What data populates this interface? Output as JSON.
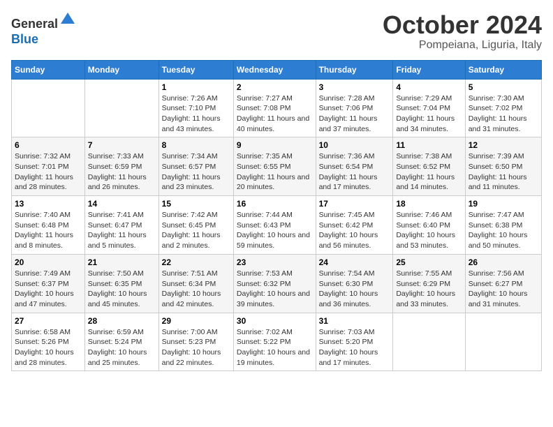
{
  "header": {
    "logo_general": "General",
    "logo_blue": "Blue",
    "month": "October 2024",
    "location": "Pompeiana, Liguria, Italy"
  },
  "days_of_week": [
    "Sunday",
    "Monday",
    "Tuesday",
    "Wednesday",
    "Thursday",
    "Friday",
    "Saturday"
  ],
  "weeks": [
    [
      {
        "num": "",
        "sunrise": "",
        "sunset": "",
        "daylight": ""
      },
      {
        "num": "",
        "sunrise": "",
        "sunset": "",
        "daylight": ""
      },
      {
        "num": "1",
        "sunrise": "Sunrise: 7:26 AM",
        "sunset": "Sunset: 7:10 PM",
        "daylight": "Daylight: 11 hours and 43 minutes."
      },
      {
        "num": "2",
        "sunrise": "Sunrise: 7:27 AM",
        "sunset": "Sunset: 7:08 PM",
        "daylight": "Daylight: 11 hours and 40 minutes."
      },
      {
        "num": "3",
        "sunrise": "Sunrise: 7:28 AM",
        "sunset": "Sunset: 7:06 PM",
        "daylight": "Daylight: 11 hours and 37 minutes."
      },
      {
        "num": "4",
        "sunrise": "Sunrise: 7:29 AM",
        "sunset": "Sunset: 7:04 PM",
        "daylight": "Daylight: 11 hours and 34 minutes."
      },
      {
        "num": "5",
        "sunrise": "Sunrise: 7:30 AM",
        "sunset": "Sunset: 7:02 PM",
        "daylight": "Daylight: 11 hours and 31 minutes."
      }
    ],
    [
      {
        "num": "6",
        "sunrise": "Sunrise: 7:32 AM",
        "sunset": "Sunset: 7:01 PM",
        "daylight": "Daylight: 11 hours and 28 minutes."
      },
      {
        "num": "7",
        "sunrise": "Sunrise: 7:33 AM",
        "sunset": "Sunset: 6:59 PM",
        "daylight": "Daylight: 11 hours and 26 minutes."
      },
      {
        "num": "8",
        "sunrise": "Sunrise: 7:34 AM",
        "sunset": "Sunset: 6:57 PM",
        "daylight": "Daylight: 11 hours and 23 minutes."
      },
      {
        "num": "9",
        "sunrise": "Sunrise: 7:35 AM",
        "sunset": "Sunset: 6:55 PM",
        "daylight": "Daylight: 11 hours and 20 minutes."
      },
      {
        "num": "10",
        "sunrise": "Sunrise: 7:36 AM",
        "sunset": "Sunset: 6:54 PM",
        "daylight": "Daylight: 11 hours and 17 minutes."
      },
      {
        "num": "11",
        "sunrise": "Sunrise: 7:38 AM",
        "sunset": "Sunset: 6:52 PM",
        "daylight": "Daylight: 11 hours and 14 minutes."
      },
      {
        "num": "12",
        "sunrise": "Sunrise: 7:39 AM",
        "sunset": "Sunset: 6:50 PM",
        "daylight": "Daylight: 11 hours and 11 minutes."
      }
    ],
    [
      {
        "num": "13",
        "sunrise": "Sunrise: 7:40 AM",
        "sunset": "Sunset: 6:48 PM",
        "daylight": "Daylight: 11 hours and 8 minutes."
      },
      {
        "num": "14",
        "sunrise": "Sunrise: 7:41 AM",
        "sunset": "Sunset: 6:47 PM",
        "daylight": "Daylight: 11 hours and 5 minutes."
      },
      {
        "num": "15",
        "sunrise": "Sunrise: 7:42 AM",
        "sunset": "Sunset: 6:45 PM",
        "daylight": "Daylight: 11 hours and 2 minutes."
      },
      {
        "num": "16",
        "sunrise": "Sunrise: 7:44 AM",
        "sunset": "Sunset: 6:43 PM",
        "daylight": "Daylight: 10 hours and 59 minutes."
      },
      {
        "num": "17",
        "sunrise": "Sunrise: 7:45 AM",
        "sunset": "Sunset: 6:42 PM",
        "daylight": "Daylight: 10 hours and 56 minutes."
      },
      {
        "num": "18",
        "sunrise": "Sunrise: 7:46 AM",
        "sunset": "Sunset: 6:40 PM",
        "daylight": "Daylight: 10 hours and 53 minutes."
      },
      {
        "num": "19",
        "sunrise": "Sunrise: 7:47 AM",
        "sunset": "Sunset: 6:38 PM",
        "daylight": "Daylight: 10 hours and 50 minutes."
      }
    ],
    [
      {
        "num": "20",
        "sunrise": "Sunrise: 7:49 AM",
        "sunset": "Sunset: 6:37 PM",
        "daylight": "Daylight: 10 hours and 47 minutes."
      },
      {
        "num": "21",
        "sunrise": "Sunrise: 7:50 AM",
        "sunset": "Sunset: 6:35 PM",
        "daylight": "Daylight: 10 hours and 45 minutes."
      },
      {
        "num": "22",
        "sunrise": "Sunrise: 7:51 AM",
        "sunset": "Sunset: 6:34 PM",
        "daylight": "Daylight: 10 hours and 42 minutes."
      },
      {
        "num": "23",
        "sunrise": "Sunrise: 7:53 AM",
        "sunset": "Sunset: 6:32 PM",
        "daylight": "Daylight: 10 hours and 39 minutes."
      },
      {
        "num": "24",
        "sunrise": "Sunrise: 7:54 AM",
        "sunset": "Sunset: 6:30 PM",
        "daylight": "Daylight: 10 hours and 36 minutes."
      },
      {
        "num": "25",
        "sunrise": "Sunrise: 7:55 AM",
        "sunset": "Sunset: 6:29 PM",
        "daylight": "Daylight: 10 hours and 33 minutes."
      },
      {
        "num": "26",
        "sunrise": "Sunrise: 7:56 AM",
        "sunset": "Sunset: 6:27 PM",
        "daylight": "Daylight: 10 hours and 31 minutes."
      }
    ],
    [
      {
        "num": "27",
        "sunrise": "Sunrise: 6:58 AM",
        "sunset": "Sunset: 5:26 PM",
        "daylight": "Daylight: 10 hours and 28 minutes."
      },
      {
        "num": "28",
        "sunrise": "Sunrise: 6:59 AM",
        "sunset": "Sunset: 5:24 PM",
        "daylight": "Daylight: 10 hours and 25 minutes."
      },
      {
        "num": "29",
        "sunrise": "Sunrise: 7:00 AM",
        "sunset": "Sunset: 5:23 PM",
        "daylight": "Daylight: 10 hours and 22 minutes."
      },
      {
        "num": "30",
        "sunrise": "Sunrise: 7:02 AM",
        "sunset": "Sunset: 5:22 PM",
        "daylight": "Daylight: 10 hours and 19 minutes."
      },
      {
        "num": "31",
        "sunrise": "Sunrise: 7:03 AM",
        "sunset": "Sunset: 5:20 PM",
        "daylight": "Daylight: 10 hours and 17 minutes."
      },
      {
        "num": "",
        "sunrise": "",
        "sunset": "",
        "daylight": ""
      },
      {
        "num": "",
        "sunrise": "",
        "sunset": "",
        "daylight": ""
      }
    ]
  ]
}
